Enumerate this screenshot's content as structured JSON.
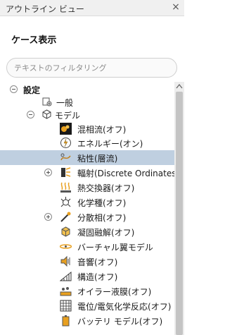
{
  "window": {
    "title": "アウトライン ビュー",
    "close_icon": "close-icon"
  },
  "section": {
    "title": "ケース表示"
  },
  "search": {
    "placeholder": "テキストのフィルタリング"
  },
  "tree": {
    "root_label": "設定",
    "general_label": "一般",
    "models_label": "モデル",
    "items": [
      {
        "label": "混相流(オフ)",
        "icon": "multiphase-icon"
      },
      {
        "label": "エネルギー(オン)",
        "icon": "energy-icon"
      },
      {
        "label": "粘性(層流)",
        "icon": "viscous-icon",
        "selected": true
      },
      {
        "label": "輻射(Discrete Ordinates)",
        "icon": "radiation-icon",
        "expandable": true
      },
      {
        "label": "熱交換器(オフ)",
        "icon": "heat-exchanger-icon"
      },
      {
        "label": "化学種(オフ)",
        "icon": "species-icon"
      },
      {
        "label": "分散相(オフ)",
        "icon": "discrete-phase-icon",
        "expandable": true
      },
      {
        "label": "凝固融解(オフ)",
        "icon": "solidification-icon"
      },
      {
        "label": "バーチャル翼モデル",
        "icon": "virtual-blade-icon"
      },
      {
        "label": "音響(オフ)",
        "icon": "acoustics-icon"
      },
      {
        "label": "構造(オフ)",
        "icon": "structure-icon"
      },
      {
        "label": "オイラー液膜(オフ)",
        "icon": "eulerian-film-icon"
      },
      {
        "label": "電位/電気化学反応(オフ)",
        "icon": "electrochemistry-icon"
      },
      {
        "label": "バッテリ モデル(オフ)",
        "icon": "battery-icon"
      }
    ]
  },
  "colors": {
    "selection": "#bfcfe0",
    "scrollbar_thumb": "#c4c4c4"
  }
}
